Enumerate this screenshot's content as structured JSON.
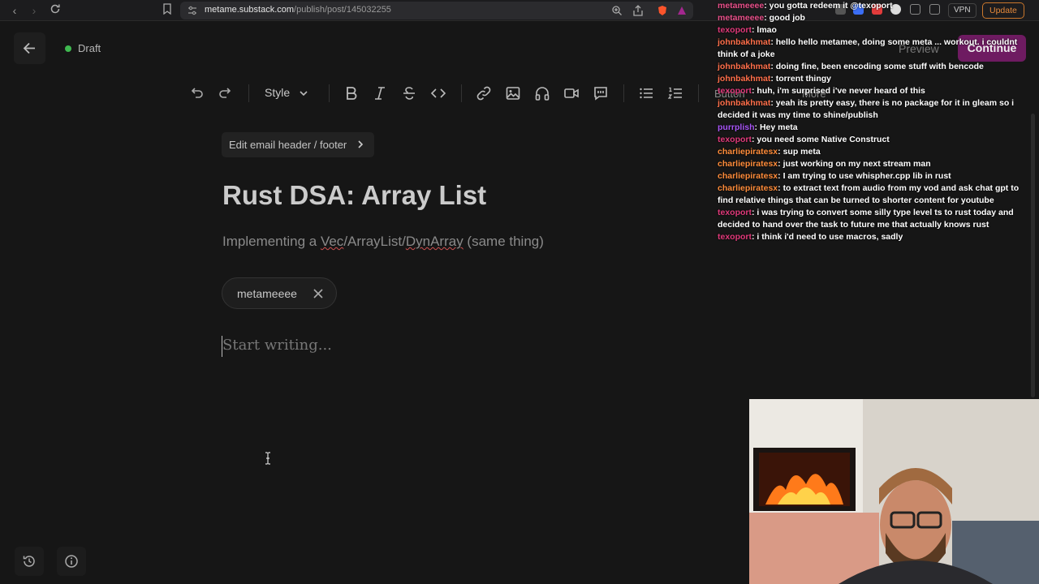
{
  "browser": {
    "url_host": "metame.substack.com",
    "url_path": "/publish/post/145032255",
    "vpn_label": "VPN",
    "update_label": "Update"
  },
  "editor": {
    "status": "Draft",
    "preview_label": "Preview",
    "continue_label": "Continue",
    "toolbar": {
      "style_label": "Style",
      "button_label": "Button",
      "more_label": "More"
    },
    "email_header_label": "Edit email header / footer",
    "title": "Rust DSA: Array List",
    "subtitle_parts": [
      "Implementing a ",
      "Vec",
      "/ArrayList/",
      "DynArray",
      " (same thing)"
    ],
    "author_chip": "metameeee",
    "body_placeholder": "Start writing..."
  },
  "chat": {
    "messages": [
      {
        "user": "metameeee",
        "color": "#e8508a",
        "text": "you gotta redeem it @texoport"
      },
      {
        "user": "metameeee",
        "color": "#e8508a",
        "text": "good job"
      },
      {
        "user": "texoport",
        "color": "#e0397a",
        "text": "lmao"
      },
      {
        "user": "johnbakhmat",
        "color": "#ff6f4a",
        "text": "hello hello metamee, doing some meta ... workout. i couldnt think of a joke"
      },
      {
        "user": "johnbakhmat",
        "color": "#ff6f4a",
        "text": "doing fine, been encoding some stuff with bencode"
      },
      {
        "user": "johnbakhmat",
        "color": "#ff6f4a",
        "text": "torrent thingy"
      },
      {
        "user": "texoport",
        "color": "#e0397a",
        "text": "huh, i'm surprised i've never heard of this"
      },
      {
        "user": "johnbakhmat",
        "color": "#ff6f4a",
        "text": "yeah its pretty easy, there is no package for it in gleam so i decided it was my time to shine/publish"
      },
      {
        "user": "purrplish",
        "color": "#a855f7",
        "text": "Hey meta"
      },
      {
        "user": "texoport",
        "color": "#e0397a",
        "text": "you need some Native Construct"
      },
      {
        "user": "charliepiratesx",
        "color": "#ff8c3a",
        "text": "sup meta"
      },
      {
        "user": "charliepiratesx",
        "color": "#ff8c3a",
        "text": "just working on my next stream man"
      },
      {
        "user": "charliepiratesx",
        "color": "#ff8c3a",
        "text": "I am trying to use whispher.cpp lib in rust"
      },
      {
        "user": "charliepiratesx",
        "color": "#ff8c3a",
        "text": "to extract text from audio from my vod and ask chat gpt to find relative things that can be turned to shorter content for youtube"
      },
      {
        "user": "texoport",
        "color": "#e0397a",
        "text": "i was trying to convert some silly type level ts to rust today and decided to hand over the task to future me that actually knows rust"
      },
      {
        "user": "texoport",
        "color": "#e0397a",
        "text": "i think i'd need to use macros, sadly"
      }
    ]
  }
}
